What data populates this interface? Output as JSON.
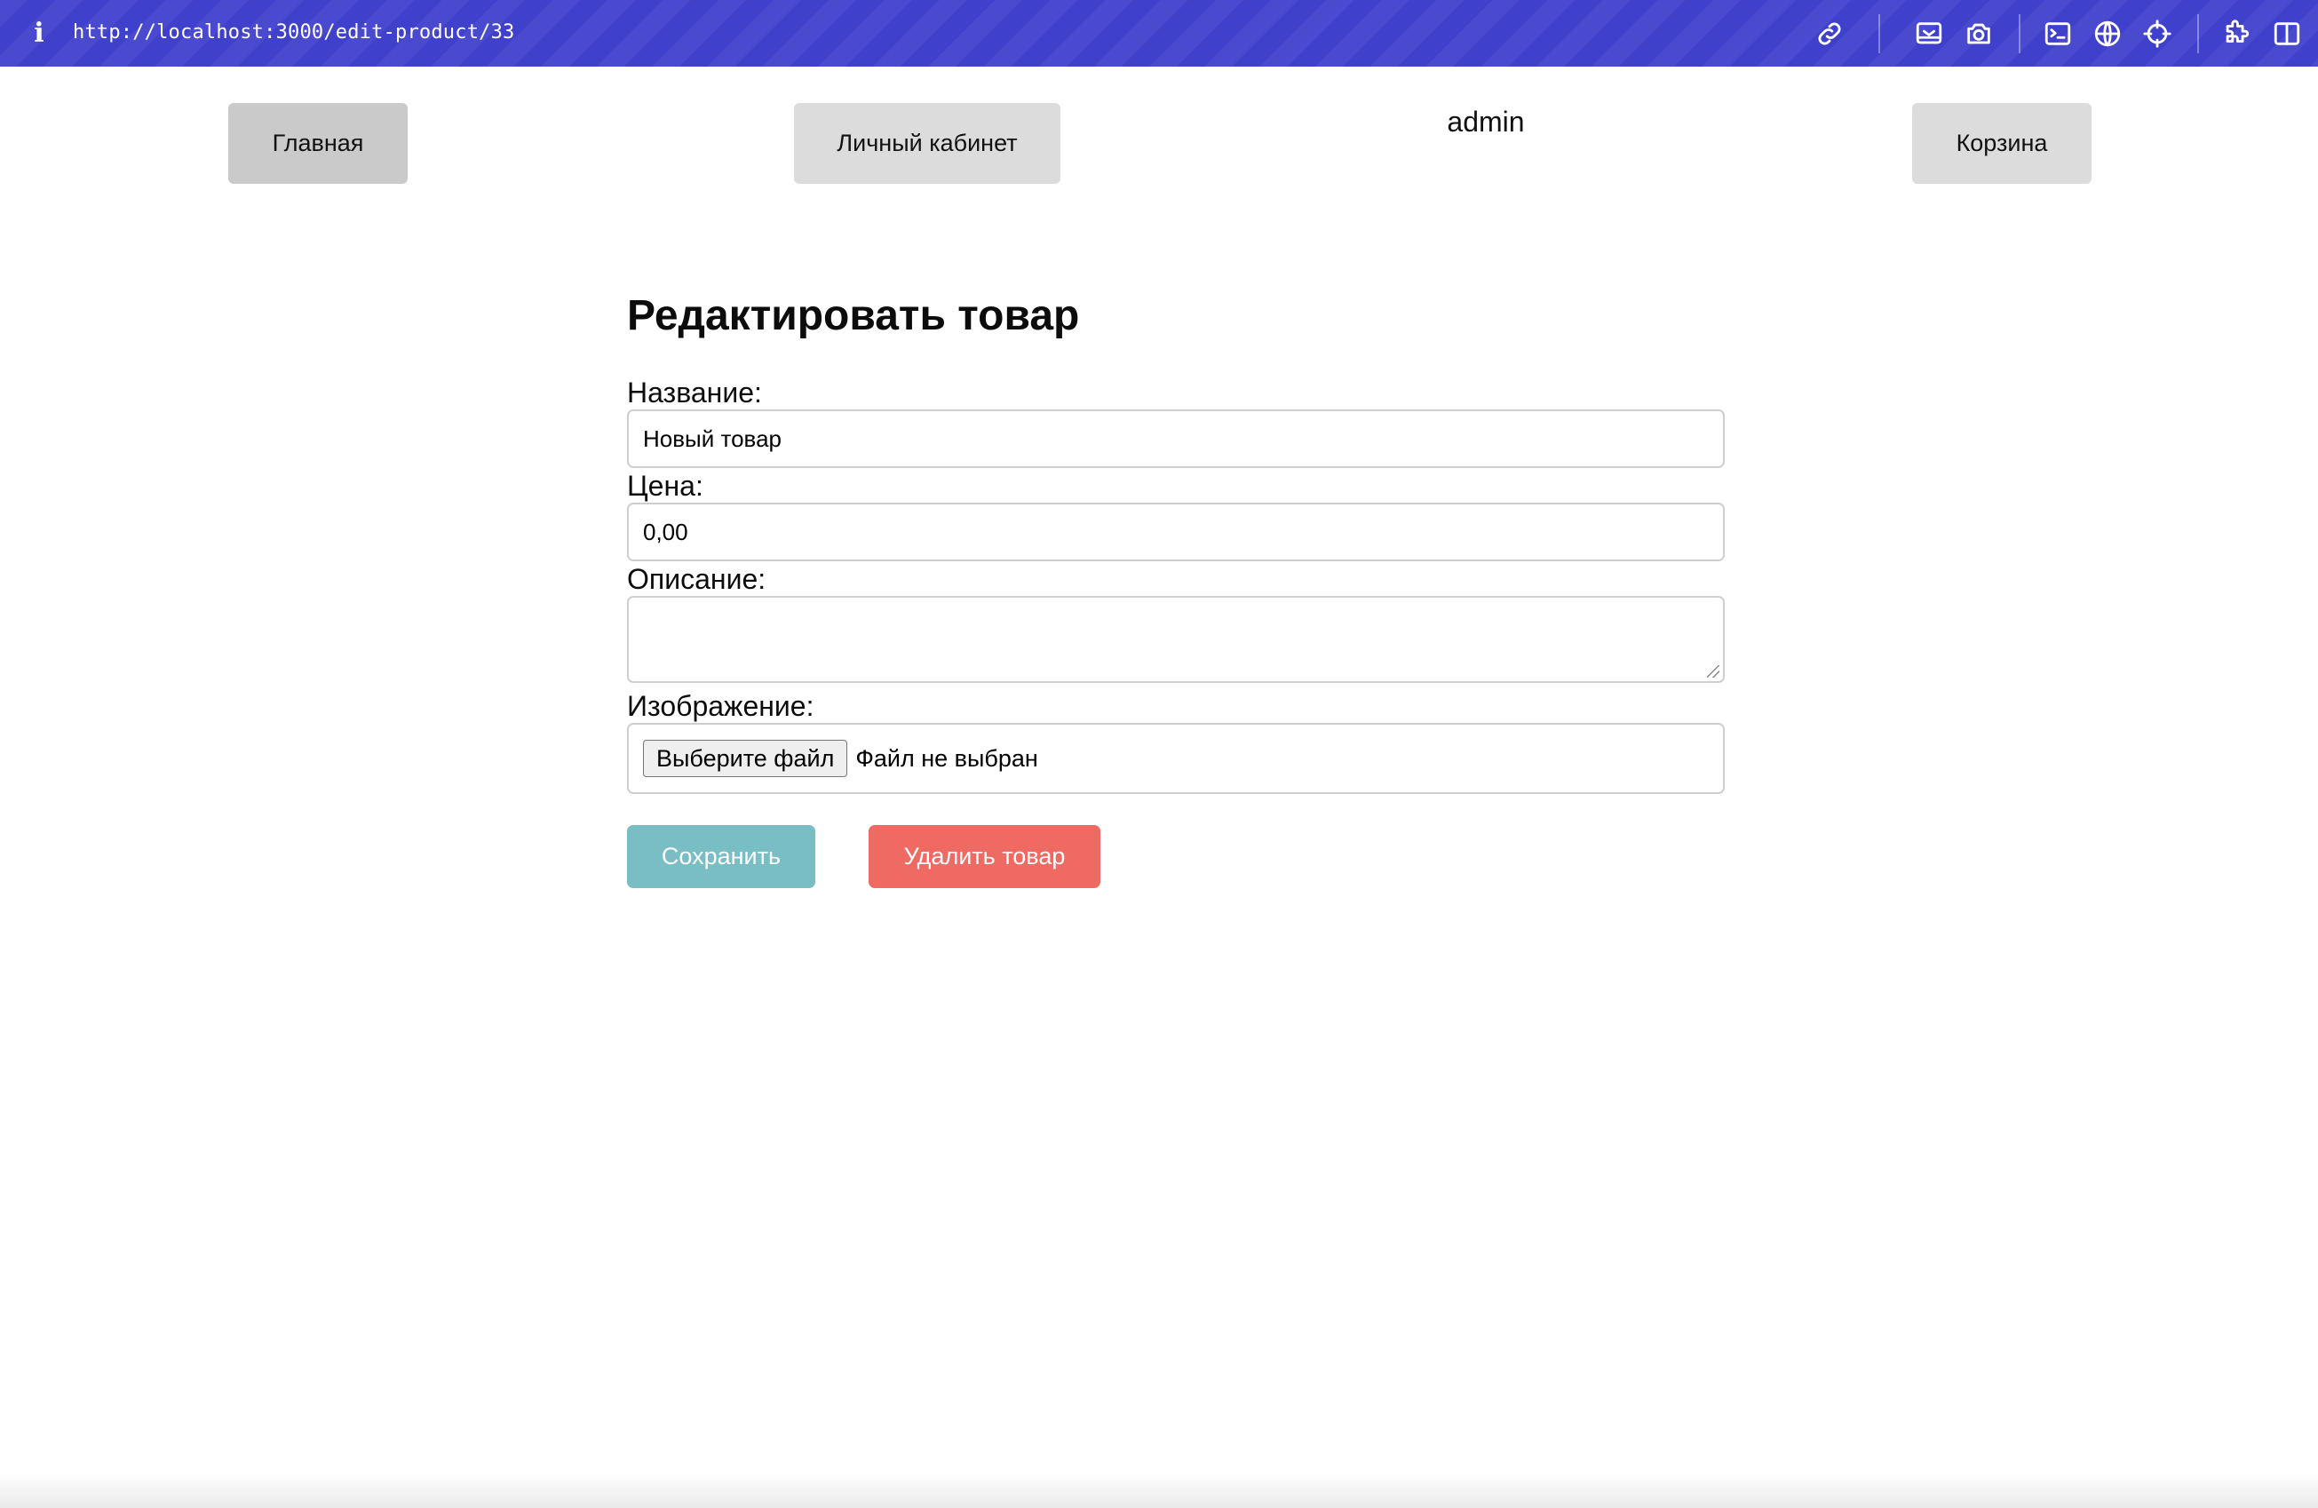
{
  "browser": {
    "url": "http://localhost:3000/edit-product/33",
    "info_icon": "i",
    "toolbar_icons": [
      "link-icon",
      "responsive-icon",
      "camera-icon",
      "terminal-icon",
      "globe-icon",
      "crosshair-icon",
      "extensions-icon",
      "sidebar-icon"
    ],
    "accent_color": "#3f40cc"
  },
  "nav": {
    "home_label": "Главная",
    "account_label": "Личный кабинет",
    "username": "admin",
    "cart_label": "Корзина"
  },
  "form": {
    "title": "Редактировать товар",
    "name_label": "Название:",
    "name_value": "Новый товар",
    "price_label": "Цена:",
    "price_value": "0,00",
    "description_label": "Описание:",
    "description_value": "",
    "image_label": "Изображение:",
    "file_button_label": "Выберите файл",
    "file_status": "Файл не выбран",
    "save_label": "Сохранить",
    "delete_label": "Удалить товар",
    "save_color": "#79bec4",
    "delete_color": "#ef6a63"
  }
}
